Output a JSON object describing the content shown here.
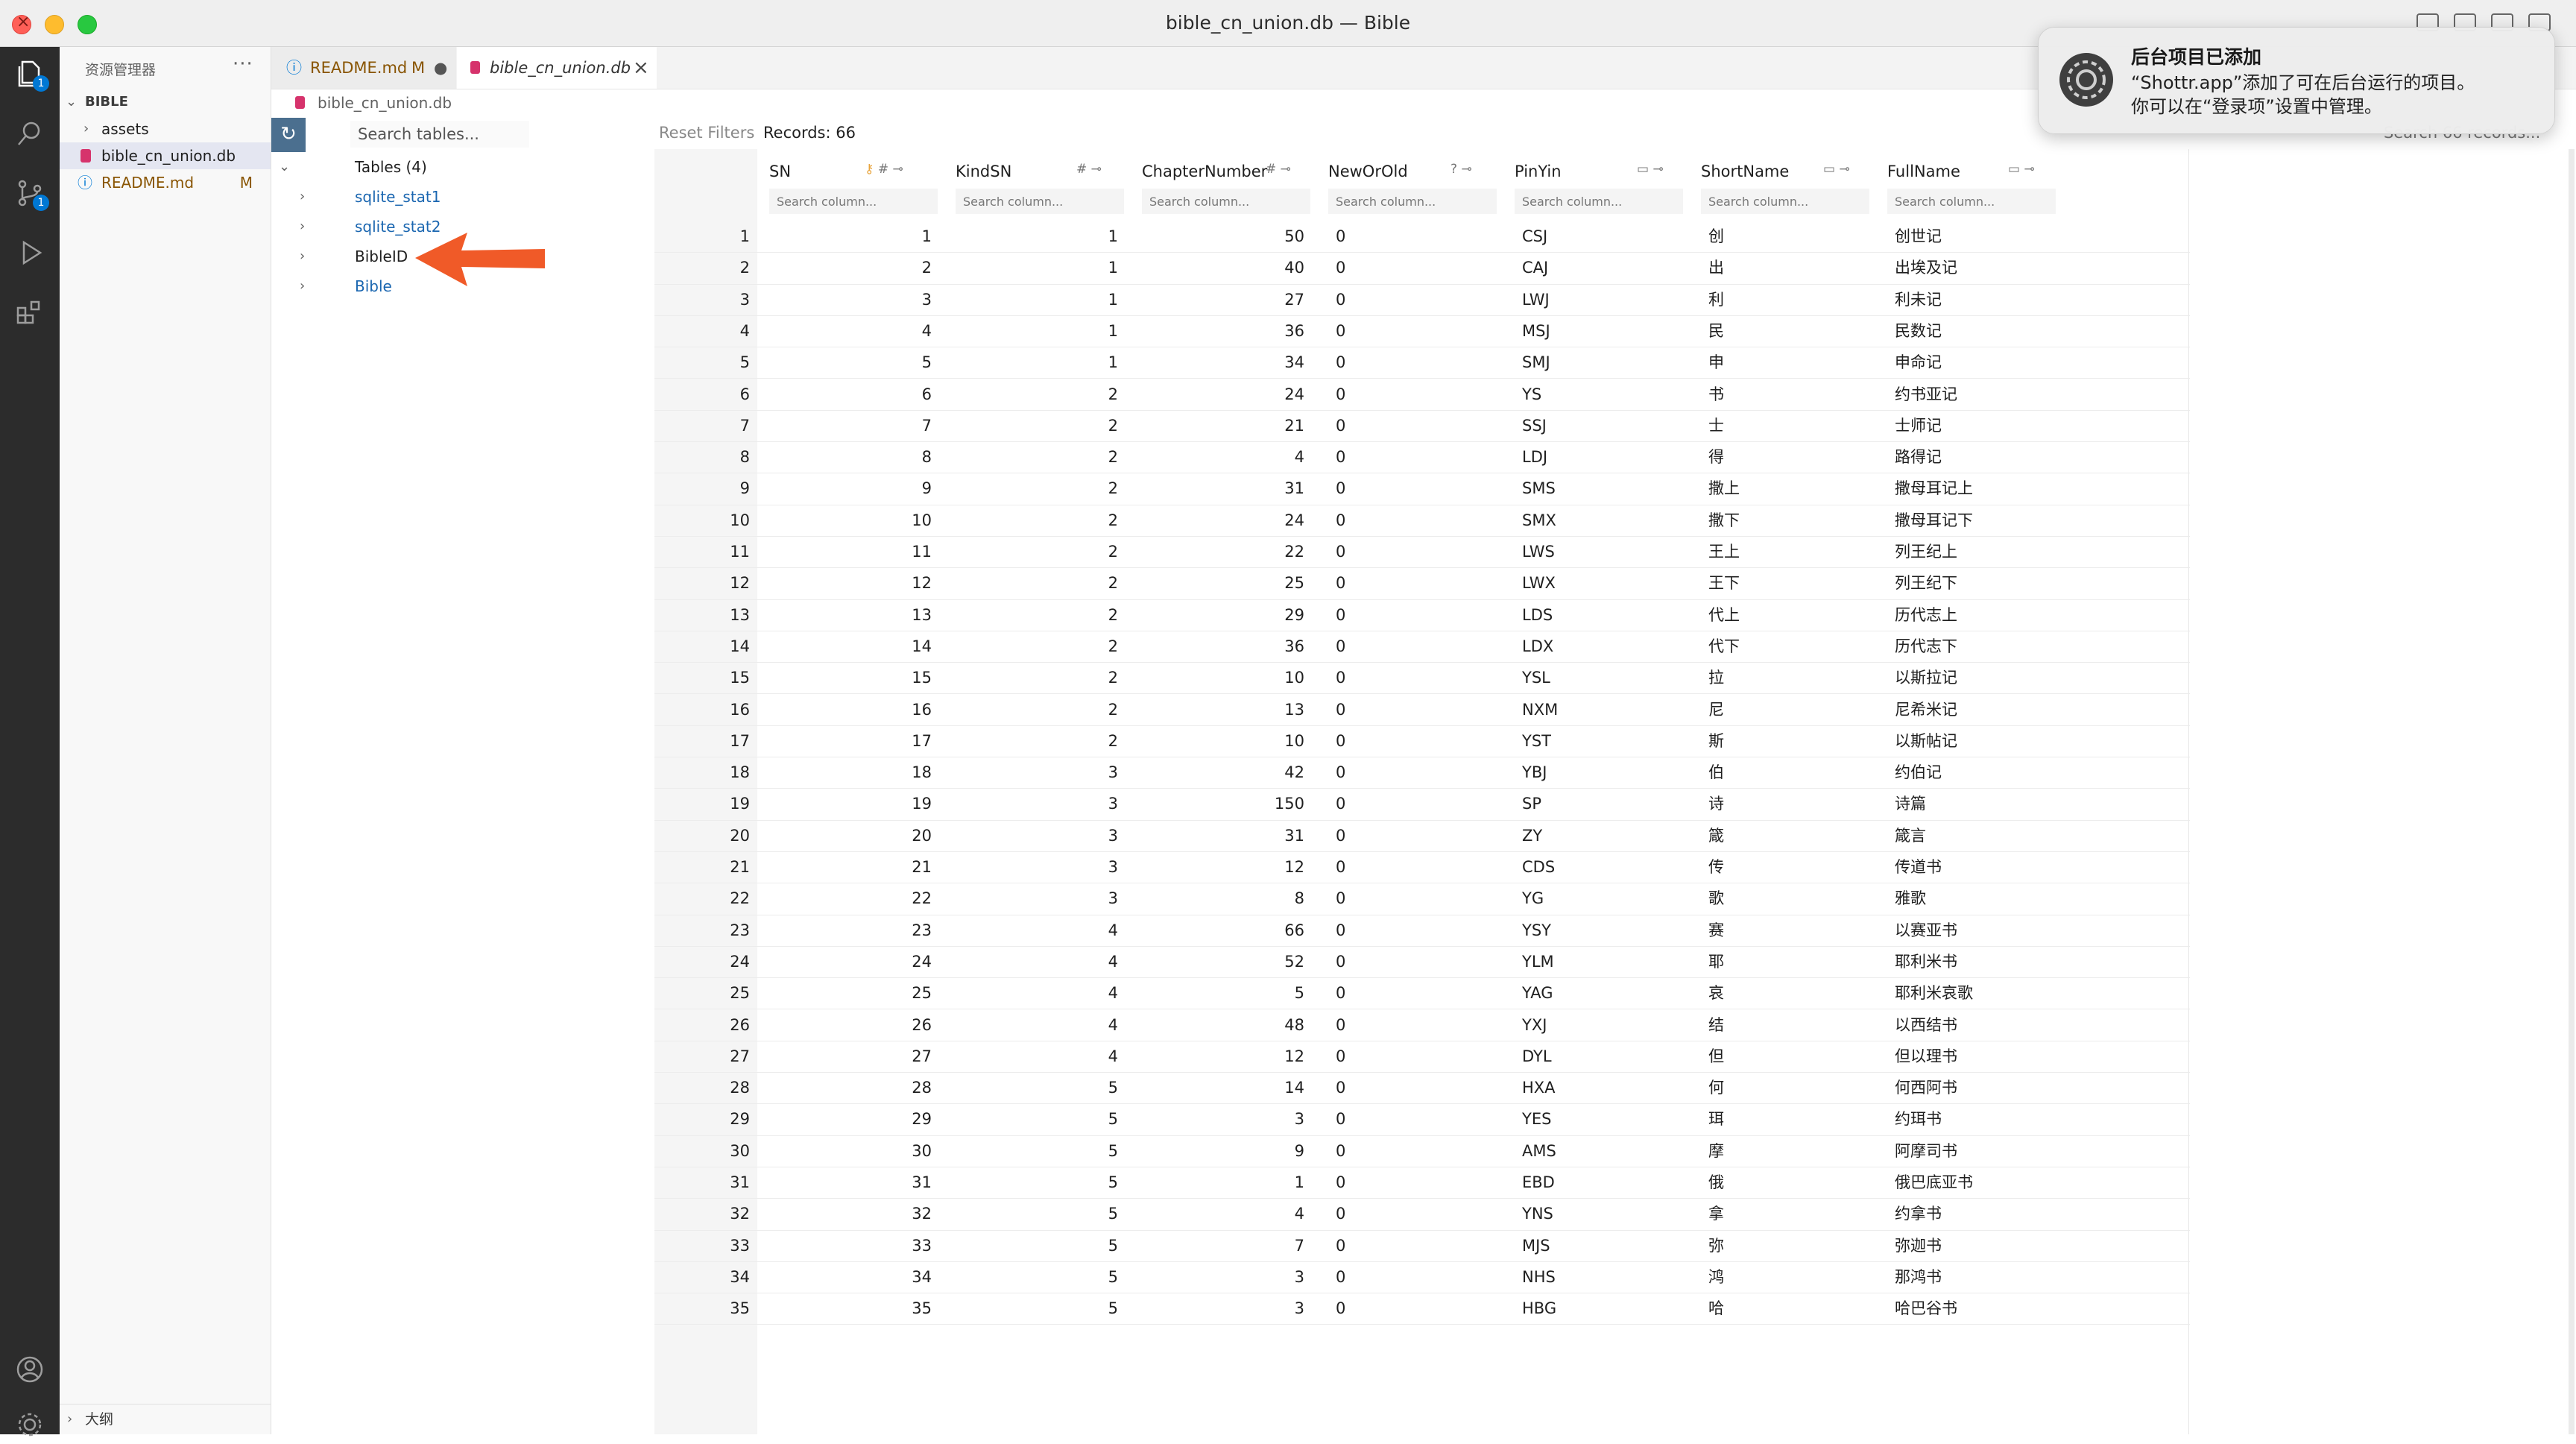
{
  "window": {
    "title": "bible_cn_union.db — Bible"
  },
  "sidebar": {
    "title": "资源管理器",
    "more": "···",
    "folder": "BIBLE",
    "items": [
      {
        "label": "assets",
        "mod": ""
      },
      {
        "label": "bible_cn_union.db",
        "mod": ""
      },
      {
        "label": "README.md",
        "mod": "M"
      }
    ],
    "outline": "大纲"
  },
  "activity": {
    "explorer_badge": "1",
    "scm_badge": "1"
  },
  "tabs": [
    {
      "label": "README.md",
      "mod": "M",
      "dot": "●"
    },
    {
      "label": "bible_cn_union.db",
      "close": "×"
    }
  ],
  "breadcrumb": "bible_cn_union.db",
  "tables_panel": {
    "search_placeholder": "Search tables...",
    "group": "Tables (4)",
    "tables": [
      "sqlite_stat1",
      "sqlite_stat2",
      "BibleID",
      "Bible"
    ]
  },
  "grid": {
    "reset": "Reset Filters",
    "records": "Records: 66",
    "search_placeholder": "Search 66 records...",
    "column_search_placeholder": "Search column...",
    "columns": [
      "SN",
      "KindSN",
      "ChapterNumber",
      "NewOrOld",
      "PinYin",
      "ShortName",
      "FullName"
    ],
    "rows": [
      [
        "1",
        "1",
        "1",
        "50",
        "0",
        "CSJ",
        "创",
        "创世记"
      ],
      [
        "2",
        "2",
        "1",
        "40",
        "0",
        "CAJ",
        "出",
        "出埃及记"
      ],
      [
        "3",
        "3",
        "1",
        "27",
        "0",
        "LWJ",
        "利",
        "利未记"
      ],
      [
        "4",
        "4",
        "1",
        "36",
        "0",
        "MSJ",
        "民",
        "民数记"
      ],
      [
        "5",
        "5",
        "1",
        "34",
        "0",
        "SMJ",
        "申",
        "申命记"
      ],
      [
        "6",
        "6",
        "2",
        "24",
        "0",
        "YS",
        "书",
        "约书亚记"
      ],
      [
        "7",
        "7",
        "2",
        "21",
        "0",
        "SSJ",
        "士",
        "士师记"
      ],
      [
        "8",
        "8",
        "2",
        "4",
        "0",
        "LDJ",
        "得",
        "路得记"
      ],
      [
        "9",
        "9",
        "2",
        "31",
        "0",
        "SMS",
        "撒上",
        "撒母耳记上"
      ],
      [
        "10",
        "10",
        "2",
        "24",
        "0",
        "SMX",
        "撒下",
        "撒母耳记下"
      ],
      [
        "11",
        "11",
        "2",
        "22",
        "0",
        "LWS",
        "王上",
        "列王纪上"
      ],
      [
        "12",
        "12",
        "2",
        "25",
        "0",
        "LWX",
        "王下",
        "列王纪下"
      ],
      [
        "13",
        "13",
        "2",
        "29",
        "0",
        "LDS",
        "代上",
        "历代志上"
      ],
      [
        "14",
        "14",
        "2",
        "36",
        "0",
        "LDX",
        "代下",
        "历代志下"
      ],
      [
        "15",
        "15",
        "2",
        "10",
        "0",
        "YSL",
        "拉",
        "以斯拉记"
      ],
      [
        "16",
        "16",
        "2",
        "13",
        "0",
        "NXM",
        "尼",
        "尼希米记"
      ],
      [
        "17",
        "17",
        "2",
        "10",
        "0",
        "YST",
        "斯",
        "以斯帖记"
      ],
      [
        "18",
        "18",
        "3",
        "42",
        "0",
        "YBJ",
        "伯",
        "约伯记"
      ],
      [
        "19",
        "19",
        "3",
        "150",
        "0",
        "SP",
        "诗",
        "诗篇"
      ],
      [
        "20",
        "20",
        "3",
        "31",
        "0",
        "ZY",
        "箴",
        "箴言"
      ],
      [
        "21",
        "21",
        "3",
        "12",
        "0",
        "CDS",
        "传",
        "传道书"
      ],
      [
        "22",
        "22",
        "3",
        "8",
        "0",
        "YG",
        "歌",
        "雅歌"
      ],
      [
        "23",
        "23",
        "4",
        "66",
        "0",
        "YSY",
        "赛",
        "以赛亚书"
      ],
      [
        "24",
        "24",
        "4",
        "52",
        "0",
        "YLM",
        "耶",
        "耶利米书"
      ],
      [
        "25",
        "25",
        "4",
        "5",
        "0",
        "YAG",
        "哀",
        "耶利米哀歌"
      ],
      [
        "26",
        "26",
        "4",
        "48",
        "0",
        "YXJ",
        "结",
        "以西结书"
      ],
      [
        "27",
        "27",
        "4",
        "12",
        "0",
        "DYL",
        "但",
        "但以理书"
      ],
      [
        "28",
        "28",
        "5",
        "14",
        "0",
        "HXA",
        "何",
        "何西阿书"
      ],
      [
        "29",
        "29",
        "5",
        "3",
        "0",
        "YES",
        "珥",
        "约珥书"
      ],
      [
        "30",
        "30",
        "5",
        "9",
        "0",
        "AMS",
        "摩",
        "阿摩司书"
      ],
      [
        "31",
        "31",
        "5",
        "1",
        "0",
        "EBD",
        "俄",
        "俄巴底亚书"
      ],
      [
        "32",
        "32",
        "5",
        "4",
        "0",
        "YNS",
        "拿",
        "约拿书"
      ],
      [
        "33",
        "33",
        "5",
        "7",
        "0",
        "MJS",
        "弥",
        "弥迦书"
      ],
      [
        "34",
        "34",
        "5",
        "3",
        "0",
        "NHS",
        "鸿",
        "那鸿书"
      ],
      [
        "35",
        "35",
        "5",
        "3",
        "0",
        "HBG",
        "哈",
        "哈巴谷书"
      ]
    ]
  },
  "notification": {
    "title": "后台项目已添加",
    "line1": "“Shottr.app”添加了可在后台运行的项目。",
    "line2": "你可以在“登录项”设置中管理。"
  },
  "colors": {
    "accent": "#0078d4",
    "link": "#1a66b0",
    "arrow": "#f05a28",
    "modified": "#895503"
  }
}
